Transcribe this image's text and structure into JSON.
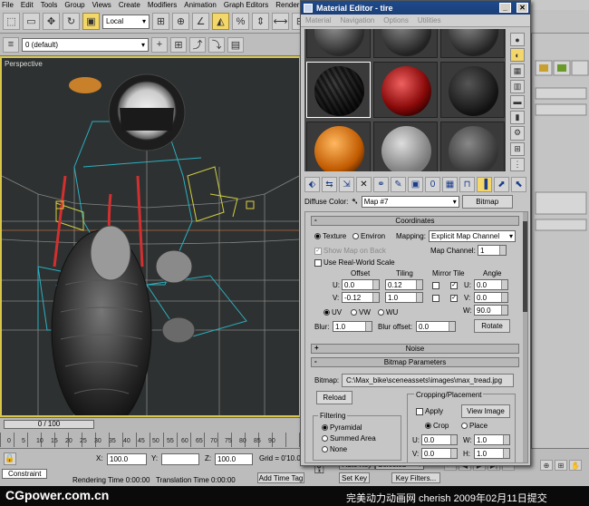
{
  "menubar": [
    "File",
    "Edit",
    "Tools",
    "Group",
    "Views",
    "Create",
    "Modifiers",
    "Animation",
    "Graph Editors",
    "Rendering"
  ],
  "main_toolbar": {
    "reference_coord": "Local"
  },
  "layer_toolbar": {
    "layer": "0 (default)"
  },
  "viewport": {
    "label": "Perspective"
  },
  "timeline": {
    "slider": "0 / 100",
    "ticks": [
      "0",
      "5",
      "10",
      "15",
      "20",
      "25",
      "30",
      "35",
      "40",
      "45",
      "50",
      "55",
      "60",
      "65",
      "70",
      "75",
      "80",
      "85",
      "90"
    ]
  },
  "status": {
    "x_label": "X:",
    "x_value": "100.0",
    "y_label": "Y:",
    "z_label": "Z:",
    "z_value": "100.0",
    "grid": "Grid = 0'10.0\"",
    "auto_key": "Auto Key",
    "selected": "Selected",
    "set_key": "Set Key",
    "key_filters": "Key Filters...",
    "add_time_tag": "Add Time Tag",
    "rendering_time": "Rendering Time  0:00:00",
    "translation_time": "Translation Time  0:00:00",
    "constraint": "Constraint"
  },
  "brand": {
    "left": "CGpower.com.cn",
    "right": "完美动力动画网 cherish 2009年02月11日提交"
  },
  "material_editor": {
    "title": "Material Editor - tire",
    "menu": [
      "Material",
      "Navigation",
      "Options",
      "Utilities"
    ],
    "diffuse_label": "Diffuse Color:",
    "map_name": "Map #7",
    "map_type": "Bitmap",
    "coordinates": {
      "header": "Coordinates",
      "texture": "Texture",
      "environ": "Environ",
      "mapping_label": "Mapping:",
      "mapping_value": "Explicit Map Channel",
      "show_map": "Show Map on Back",
      "map_channel_label": "Map Channel:",
      "map_channel_value": "1",
      "real_world": "Use Real-World Scale",
      "col_offset": "Offset",
      "col_tiling": "Tiling",
      "col_mirror_tile": "Mirror Tile",
      "col_angle": "Angle",
      "u_label": "U:",
      "v_label": "V:",
      "w_label": "W:",
      "u_offset": "0.0",
      "v_offset": "-0.12",
      "u_tiling": "0.12",
      "v_tiling": "1.0",
      "u_angle": "0.0",
      "v_angle": "0.0",
      "w_angle": "90.0",
      "uv": "UV",
      "vw": "VW",
      "wu": "WU",
      "blur_label": "Blur:",
      "blur_value": "1.0",
      "blur_offset_label": "Blur offset:",
      "blur_offset_value": "0.0",
      "rotate": "Rotate"
    },
    "noise": {
      "header": "Noise"
    },
    "bitmap_params": {
      "header": "Bitmap Parameters",
      "bitmap_label": "Bitmap:",
      "bitmap_path": "C:\\Max_bike\\sceneassets\\images\\max_tread.jpg",
      "reload": "Reload",
      "cropping": "Cropping/Placement",
      "apply": "Apply",
      "view_image": "View Image",
      "crop": "Crop",
      "place": "Place",
      "filtering": "Filtering",
      "pyramidal": "Pyramidal",
      "summed_area": "Summed Area",
      "none": "None",
      "u_label": "U:",
      "v_label": "V:",
      "w_label": "W:",
      "h_label": "H:",
      "u_value": "0.0",
      "v_value": "0.0",
      "w_value": "1.0",
      "h_value": "1.0"
    }
  }
}
